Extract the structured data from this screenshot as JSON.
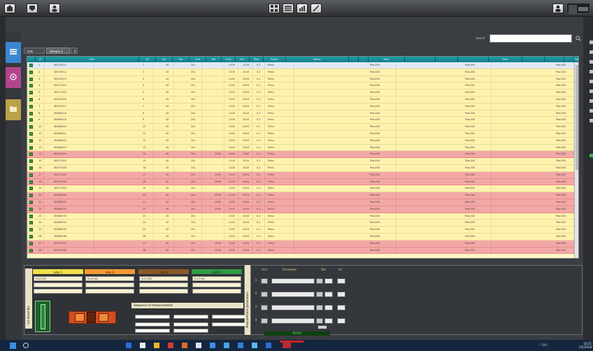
{
  "toolbar": {
    "left_icons": [
      "export-icon",
      "import-icon",
      "user-icon"
    ],
    "center_icons": [
      "grid-layout-icon",
      "table-view-icon",
      "chart-icon",
      "edit-icon"
    ],
    "right_icons": [
      "operator-icon",
      "info-icon"
    ]
  },
  "sidebar": {
    "tabs": [
      {
        "icon": "list-icon",
        "color": "#3a86d1"
      },
      {
        "icon": "settings-icon",
        "color": "#b0468c"
      },
      {
        "icon": "folder-icon",
        "color": "#bba14a"
      }
    ]
  },
  "search": {
    "label": "search",
    "value": "",
    "placeholder": ""
  },
  "tabs": [
    "Lots",
    "Sample 1",
    "3"
  ],
  "table": {
    "columns": [
      "",
      "#",
      "Item",
      "Col",
      "Qty",
      "Pos",
      "Unit",
      "Ref",
      "Limit",
      "Min",
      "Max",
      "Status",
      "Name",
      "",
      "",
      "Date",
      "",
      "",
      "",
      "Date",
      "",
      "",
      "",
      "Date"
    ],
    "rows": [
      {
        "n": "1",
        "item": "SB470011",
        "a": "1",
        "b": "40",
        "c": "20L",
        "d": "",
        "e": "2100",
        "f": "1416",
        "g": "0.2",
        "name": "Pinto",
        "date1": "Plan200",
        "date2": "Plan200",
        "date3": "Plan200",
        "state": "sel"
      },
      {
        "n": "2",
        "item": "SB470012",
        "a": "2",
        "b": "40",
        "c": "20L",
        "d": "",
        "e": "2100",
        "f": "2016",
        "g": "0.2",
        "name": "Pinto",
        "date1": "Plan200",
        "date2": "Plan200",
        "date3": "Plan200",
        "state": "yellow"
      },
      {
        "n": "3",
        "item": "SB470013",
        "a": "3",
        "b": "40",
        "c": "20L",
        "d": "",
        "e": "2100",
        "f": "2016",
        "g": "0.2",
        "name": "Pinto",
        "date1": "Plan200",
        "date2": "Plan200",
        "date3": "Plan200",
        "state": "yellow"
      },
      {
        "n": "4",
        "item": "SB47T014",
        "a": "4",
        "b": "40",
        "c": "20L",
        "d": "",
        "e": "2100",
        "f": "2016",
        "g": "0.2",
        "name": "Pinto",
        "date1": "Plan200",
        "date2": "Plan200",
        "date3": "Plan200",
        "state": "yellow"
      },
      {
        "n": "5",
        "item": "SB47T015",
        "a": "5",
        "b": "40",
        "c": "20L",
        "d": "",
        "e": "2100",
        "f": "2016",
        "g": "0.2",
        "name": "Pinto",
        "date1": "Plan200",
        "date2": "Plan200",
        "date3": "Plan200",
        "state": "yellow"
      },
      {
        "n": "6",
        "item": "SB470016",
        "a": "6",
        "b": "40",
        "c": "20L",
        "d": "",
        "e": "2100",
        "f": "2016",
        "g": "0.2",
        "name": "Pinto",
        "date1": "Plan200",
        "date2": "Plan200",
        "date3": "Plan200",
        "state": "yellow"
      },
      {
        "n": "7",
        "item": "SB470017",
        "a": "7",
        "b": "40",
        "c": "20L",
        "d": "",
        "e": "2100",
        "f": "2016",
        "g": "0.2",
        "name": "Pinto",
        "date1": "Plan200",
        "date2": "Plan200",
        "date3": "Plan200",
        "state": "yellow"
      },
      {
        "n": "8",
        "item": "SB480018",
        "a": "8",
        "b": "40",
        "c": "20L",
        "d": "",
        "e": "2100",
        "f": "1416",
        "g": "0.2",
        "name": "Pinto",
        "date1": "Plan200",
        "date2": "Plan200",
        "date3": "Plan200",
        "state": "yellow"
      },
      {
        "n": "9",
        "item": "SB480019",
        "a": "9",
        "b": "40",
        "c": "20L",
        "d": "",
        "e": "2100",
        "f": "2016",
        "g": "0.2",
        "name": "Pinto",
        "date1": "Plan200",
        "date2": "Plan200",
        "date3": "Plan200",
        "state": "yellow"
      },
      {
        "n": "10",
        "item": "SB480020",
        "a": "10",
        "b": "40",
        "c": "20L",
        "d": "",
        "e": "2100",
        "f": "2016",
        "g": "0.2",
        "name": "Pinto",
        "date1": "Plan200",
        "date2": "Plan200",
        "date3": "Plan200",
        "state": "yellow"
      },
      {
        "n": "11",
        "item": "SB480021",
        "a": "11",
        "b": "40",
        "c": "20L",
        "d": "",
        "e": "2100",
        "f": "2016",
        "g": "0.2",
        "name": "Pinto",
        "date1": "Plan200",
        "date2": "Plan200",
        "date3": "Plan200",
        "state": "yellow"
      },
      {
        "n": "12",
        "item": "SB480022",
        "a": "12",
        "b": "40",
        "c": "20L",
        "d": "",
        "e": "2100",
        "f": "2016",
        "g": "0.2",
        "name": "Pinto",
        "date1": "Plan200",
        "date2": "Plan200",
        "date3": "Plan200",
        "state": "yellow"
      },
      {
        "n": "13",
        "item": "SB480023",
        "a": "13",
        "b": "40",
        "c": "20L",
        "d": "",
        "e": "2100",
        "f": "2016",
        "g": "0.2",
        "name": "Pinto",
        "date1": "Plan200",
        "date2": "Plan200",
        "date3": "Plan200",
        "state": "yellow"
      },
      {
        "n": "14",
        "item": "SB470024",
        "a": "14",
        "b": "40",
        "c": "20L",
        "d": "2500",
        "e": "2100",
        "f": "1416",
        "g": "0.2",
        "name": "Pinto",
        "date1": "Plan200",
        "date2": "Plan200",
        "date3": "Plan200",
        "state": "pink"
      },
      {
        "n": "15",
        "item": "SB47T025",
        "a": "15",
        "b": "40",
        "c": "20L",
        "d": "",
        "e": "2100",
        "f": "2016",
        "g": "0.2",
        "name": "Pinto",
        "date1": "Plan200",
        "date2": "Plan200",
        "date3": "Plan200",
        "state": "yellow"
      },
      {
        "n": "16",
        "item": "SB47T026",
        "a": "16",
        "b": "40",
        "c": "20L",
        "d": "",
        "e": "2100",
        "f": "2016",
        "g": "0.2",
        "name": "Pinto",
        "date1": "Plan200",
        "date2": "Plan200",
        "date3": "Plan200",
        "state": "yellow"
      },
      {
        "n": "17",
        "item": "SB47T027",
        "a": "17",
        "b": "40",
        "c": "20L",
        "d": "2500",
        "e": "2100",
        "f": "2016",
        "g": "0.2",
        "name": "Pinto",
        "date1": "Plan200",
        "date2": "Plan200",
        "date3": "Plan200",
        "state": "pink"
      },
      {
        "n": "18",
        "item": "SB47T028",
        "a": "18",
        "b": "40",
        "c": "20L",
        "d": "2500",
        "e": "2100",
        "f": "2016",
        "g": "0.2",
        "name": "Pinto",
        "date1": "Plan200",
        "date2": "Plan200",
        "date3": "Plan200",
        "state": "pink"
      },
      {
        "n": "19",
        "item": "SB47T029",
        "a": "19",
        "b": "40",
        "c": "20L",
        "d": "",
        "e": "2100",
        "f": "2016",
        "g": "0.2",
        "name": "Pinto",
        "date1": "Plan200",
        "date2": "Plan200",
        "date3": "Plan200",
        "state": "yellow"
      },
      {
        "n": "20",
        "item": "SB480030",
        "a": "20",
        "b": "40",
        "c": "20L",
        "d": "2500",
        "e": "2100",
        "f": "2016",
        "g": "0.2",
        "name": "Pinto",
        "date1": "Plan200",
        "date2": "Plan200",
        "date3": "Plan200",
        "state": "pink"
      },
      {
        "n": "21",
        "item": "SB480031",
        "a": "21",
        "b": "40",
        "c": "20L",
        "d": "2500",
        "e": "2100",
        "f": "2016",
        "g": "0.2",
        "name": "Pinto",
        "date1": "Plan200",
        "date2": "Plan200",
        "date3": "Plan200",
        "state": "pink"
      },
      {
        "n": "22",
        "item": "SB480032",
        "a": "22",
        "b": "40",
        "c": "20L",
        "d": "2500",
        "e": "2100",
        "f": "2016",
        "g": "0.2",
        "name": "Pinto",
        "date1": "Plan200",
        "date2": "Plan200",
        "date3": "Plan200",
        "state": "pink"
      },
      {
        "n": "23",
        "item": "SB480033",
        "a": "23",
        "b": "40",
        "c": "20L",
        "d": "",
        "e": "2100",
        "f": "2016",
        "g": "0.2",
        "name": "Pinto",
        "date1": "Plan200",
        "date2": "Plan200",
        "date3": "Plan200",
        "state": "yellow"
      },
      {
        "n": "24",
        "item": "SB480034",
        "a": "24",
        "b": "40",
        "c": "20L",
        "d": "",
        "e": "2100",
        "f": "2016",
        "g": "0.2",
        "name": "Pinto",
        "date1": "Plan200",
        "date2": "Plan200",
        "date3": "Plan200",
        "state": "yellow"
      },
      {
        "n": "25",
        "item": "SB480035",
        "a": "25",
        "b": "40",
        "c": "20L",
        "d": "",
        "e": "2100",
        "f": "2016",
        "g": "0.2",
        "name": "Pinto",
        "date1": "Plan200",
        "date2": "Plan200",
        "date3": "Plan200",
        "state": "yellow"
      },
      {
        "n": "26",
        "item": "SB480036",
        "a": "26",
        "b": "40",
        "c": "20L",
        "d": "",
        "e": "2100",
        "f": "2016",
        "g": "0.2",
        "name": "Pinto",
        "date1": "Plan200",
        "date2": "Plan200",
        "date3": "Plan200",
        "state": "yellow"
      },
      {
        "n": "27",
        "item": "SB47T037",
        "a": "27",
        "b": "40",
        "c": "20L",
        "d": "2500",
        "e": "2100",
        "f": "1416",
        "g": "0.2",
        "name": "Pinto",
        "date1": "Plan200",
        "date2": "Plan200",
        "date3": "Plan200",
        "state": "pink"
      },
      {
        "n": "28",
        "item": "SB47T038",
        "a": "28",
        "b": "40",
        "c": "20L",
        "d": "2500",
        "e": "2100",
        "f": "2016",
        "g": "0.2",
        "name": "Pinto",
        "date1": "Plan200",
        "date2": "Plan200",
        "date3": "Plan200",
        "state": "pink"
      }
    ]
  },
  "lots": {
    "vertical_label": "Lot Assembly",
    "headers": [
      {
        "label": "Lots 1",
        "color": "#f0e04a"
      },
      {
        "label": "Lots 2",
        "color": "#f29a34"
      },
      {
        "label": "Lots 3",
        "color": "#8a5a2a"
      },
      {
        "label": "Lots 4",
        "color": "#2f9a44"
      }
    ],
    "values": [
      "PLAT360",
      "PLAT360",
      "PLAT360",
      "PLAT360"
    ],
    "measure_label": "Sequence of measurements"
  },
  "params": {
    "vertical_label": "Measurement parameters",
    "headers": [
      "Unit",
      "Parameter",
      "Std",
      "Int"
    ],
    "rows": [
      "1",
      "2",
      "3",
      "4"
    ],
    "status": "READY"
  },
  "taskbar": {
    "tray": "^ ENG",
    "clock_time": "10:21",
    "clock_date": "2/5/2018"
  }
}
